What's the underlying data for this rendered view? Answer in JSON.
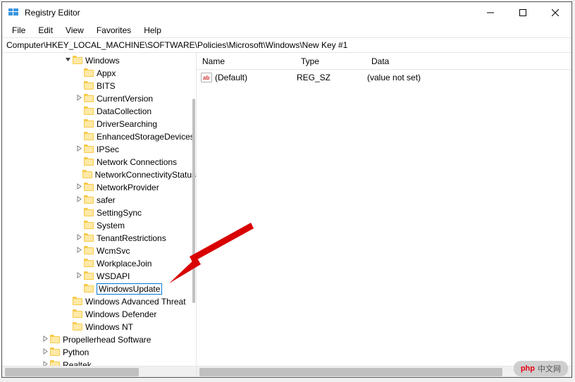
{
  "window": {
    "title": "Registry Editor"
  },
  "menu": {
    "file": "File",
    "edit": "Edit",
    "view": "View",
    "favorites": "Favorites",
    "help": "Help"
  },
  "address": "Computer\\HKEY_LOCAL_MACHINE\\SOFTWARE\\Policies\\Microsoft\\Windows\\New Key #1",
  "tree": [
    {
      "indent": 5,
      "exp": "v",
      "label": "Windows"
    },
    {
      "indent": 6,
      "exp": "",
      "label": "Appx"
    },
    {
      "indent": 6,
      "exp": "",
      "label": "BITS"
    },
    {
      "indent": 6,
      "exp": ">",
      "label": "CurrentVersion"
    },
    {
      "indent": 6,
      "exp": "",
      "label": "DataCollection"
    },
    {
      "indent": 6,
      "exp": "",
      "label": "DriverSearching"
    },
    {
      "indent": 6,
      "exp": "",
      "label": "EnhancedStorageDevices"
    },
    {
      "indent": 6,
      "exp": ">",
      "label": "IPSec"
    },
    {
      "indent": 6,
      "exp": "",
      "label": "Network Connections"
    },
    {
      "indent": 6,
      "exp": "",
      "label": "NetworkConnectivityStatus"
    },
    {
      "indent": 6,
      "exp": ">",
      "label": "NetworkProvider"
    },
    {
      "indent": 6,
      "exp": ">",
      "label": "safer"
    },
    {
      "indent": 6,
      "exp": "",
      "label": "SettingSync"
    },
    {
      "indent": 6,
      "exp": "",
      "label": "System"
    },
    {
      "indent": 6,
      "exp": ">",
      "label": "TenantRestrictions"
    },
    {
      "indent": 6,
      "exp": ">",
      "label": "WcmSvc"
    },
    {
      "indent": 6,
      "exp": "",
      "label": "WorkplaceJoin"
    },
    {
      "indent": 6,
      "exp": ">",
      "label": "WSDAPI"
    },
    {
      "indent": 6,
      "exp": "",
      "label": "WindowsUpdate",
      "editing": true
    },
    {
      "indent": 5,
      "exp": "",
      "label": "Windows Advanced Threat"
    },
    {
      "indent": 5,
      "exp": "",
      "label": "Windows Defender"
    },
    {
      "indent": 5,
      "exp": "",
      "label": "Windows NT"
    },
    {
      "indent": 3,
      "exp": ">",
      "label": "Propellerhead Software"
    },
    {
      "indent": 3,
      "exp": ">",
      "label": "Python"
    },
    {
      "indent": 3,
      "exp": ">",
      "label": "Realtek"
    }
  ],
  "list": {
    "headers": {
      "name": "Name",
      "type": "Type",
      "data": "Data"
    },
    "rows": [
      {
        "name": "(Default)",
        "type": "REG_SZ",
        "data": "(value not set)"
      }
    ]
  },
  "watermark": {
    "brand": "php",
    "text": "中文网"
  },
  "colors": {
    "folder_light": "#ffe9a6",
    "folder_dark": "#f7c948",
    "accent": "#0078d7",
    "arrow": "#d90000"
  }
}
